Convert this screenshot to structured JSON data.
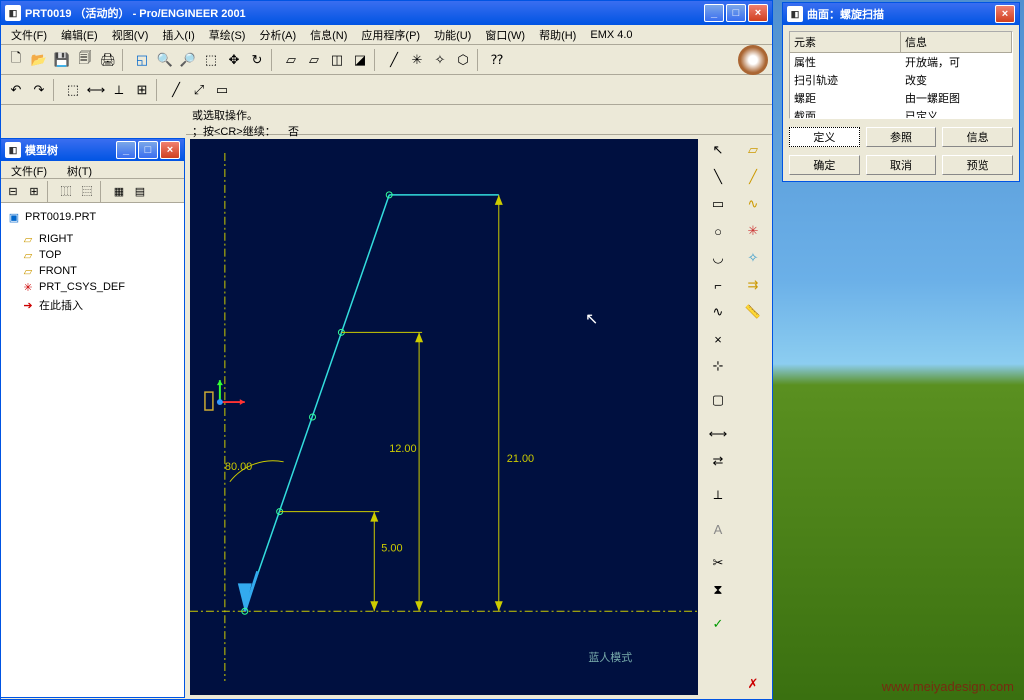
{
  "main": {
    "title": "PRT0019 （活动的） - Pro/ENGINEER 2001",
    "menus": [
      "文件(F)",
      "编辑(E)",
      "视图(V)",
      "插入(I)",
      "草绘(S)",
      "分析(A)",
      "信息(N)",
      "应用程序(P)",
      "功能(U)",
      "窗口(W)",
      "帮助(H)",
      "EMX 4.0"
    ]
  },
  "msg": {
    "line1": "或选取操作。",
    "line2a": "；按<CR>继续：",
    "line2b": "否"
  },
  "dims": {
    "d1": "21.00",
    "d2": "12.00",
    "d3": "5.00",
    "ang": "80.00"
  },
  "tree": {
    "title": "模型树",
    "menu1": "文件(F)",
    "menu2": "树(T)",
    "root": "PRT0019.PRT",
    "items": [
      "RIGHT",
      "TOP",
      "FRONT",
      "PRT_CSYS_DEF",
      "在此插入"
    ]
  },
  "dialog": {
    "title": "曲面：螺旋扫描",
    "th1": "元素",
    "th2": "信息",
    "rows": [
      {
        "k": "属性",
        "v": "开放端，可"
      },
      {
        "k": "扫引轨迹",
        "v": "改变"
      },
      {
        "k": "螺距",
        "v": "由一螺距图"
      },
      {
        "k": "截面",
        "v": "已定义"
      }
    ],
    "b1": "定义",
    "b2": "参照",
    "b3": "信息",
    "b4": "确定",
    "b5": "取消",
    "b6": "预览"
  },
  "watermark": "www.meiyadesign.com"
}
